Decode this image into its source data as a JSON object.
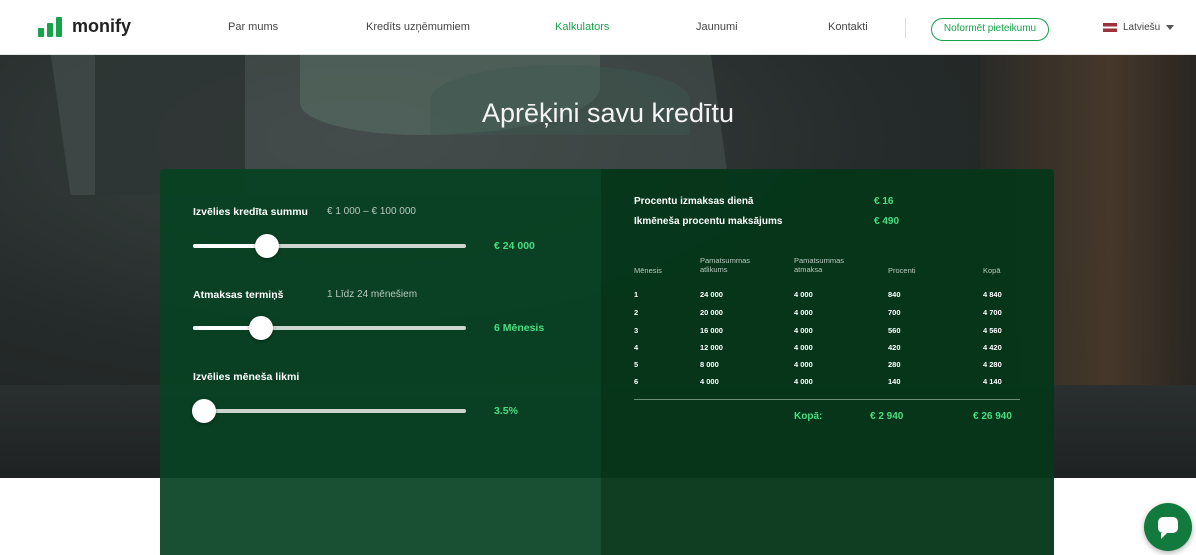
{
  "brand": {
    "name": "monify",
    "color": "#16a34a"
  },
  "nav": {
    "items": [
      {
        "label": "Par mums",
        "active": false
      },
      {
        "label": "Kredīts uzņēmumiem",
        "active": false
      },
      {
        "label": "Kalkulators",
        "active": true
      },
      {
        "label": "Jaunumi",
        "active": false
      },
      {
        "label": "Kontakti",
        "active": false
      }
    ],
    "cta_label": "Noformēt pieteikumu",
    "language": "Latviešu"
  },
  "hero": {
    "title": "Aprēķini savu kredītu"
  },
  "calculator": {
    "amount": {
      "label": "Izvēlies kredīta summu",
      "hint": "€ 1 000 – € 100 000",
      "value_text": "€ 24 000",
      "level": 0.27
    },
    "term": {
      "label": "Atmaksas termiņš",
      "hint": "1 Līdz 24 mēnešiem",
      "value_text": "6 Mēnesis",
      "level": 0.25
    },
    "rate": {
      "label": "Izvēlies mēneša likmi",
      "value_text": "3.5%",
      "level": 0.04
    }
  },
  "summary": {
    "daily_label": "Procentu izmaksas dienā",
    "daily_value": "€ 16",
    "monthly_label": "Ikmēneša procentu maksājums",
    "monthly_value": "€ 490"
  },
  "schedule": {
    "headers": [
      "Mēnesis",
      "Pamatsummas atlikums",
      "Pamatsummas atmaksa",
      "Procenti",
      "Kopā"
    ],
    "rows": [
      [
        "1",
        "24 000",
        "4 000",
        "840",
        "4 840"
      ],
      [
        "2",
        "20 000",
        "4 000",
        "700",
        "4 700"
      ],
      [
        "3",
        "16 000",
        "4 000",
        "560",
        "4 560"
      ],
      [
        "4",
        "12 000",
        "4 000",
        "420",
        "4 420"
      ],
      [
        "5",
        "8 000",
        "4 000",
        "280",
        "4 280"
      ],
      [
        "6",
        "4 000",
        "4 000",
        "140",
        "4 140"
      ]
    ],
    "total_label": "Kopā:",
    "total_interest": "€ 2 940",
    "total_sum": "€ 26 940"
  },
  "colors": {
    "accent": "#16a34a",
    "value_green": "#4ade80",
    "panel": "#084222",
    "chat": "#117a3c"
  },
  "icons": {
    "chat": "chat-bubble-icon",
    "flag": "latvia-flag-icon",
    "caret": "chevron-down-icon"
  }
}
